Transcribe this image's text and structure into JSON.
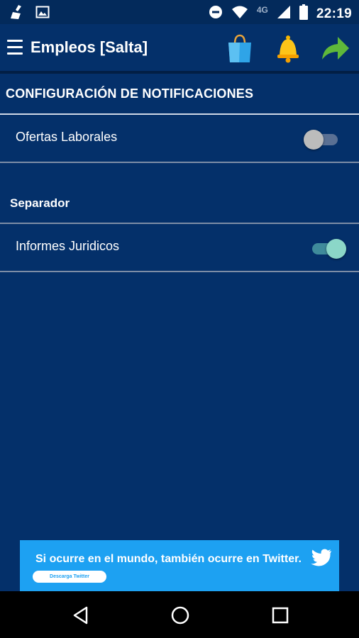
{
  "status_bar": {
    "time": "22:19",
    "network": "4G",
    "icons": [
      "cleaner-icon",
      "image-icon",
      "do-not-disturb-icon",
      "wifi-icon",
      "signal-icon",
      "battery-icon"
    ]
  },
  "app_bar": {
    "title": "Empleos [Salta]",
    "actions": [
      "shopping-bag-icon",
      "bell-icon",
      "share-arrow-icon"
    ]
  },
  "section": {
    "title": "CONFIGURACIÓN DE NOTIFICACIONES"
  },
  "settings": [
    {
      "label": "Ofertas Laborales",
      "enabled": false
    },
    {
      "label": "Informes Juridicos",
      "enabled": true
    }
  ],
  "separator": {
    "title": "Separador"
  },
  "ad": {
    "text": "Si ocurre en el mundo, también ocurre en Twitter.",
    "button_label": "Descarga Twitter",
    "background": "#1da1f2"
  },
  "nav_bar": {
    "buttons": [
      "back-icon",
      "home-icon",
      "recents-icon"
    ]
  },
  "colors": {
    "background": "#04306a",
    "toggle_on_thumb": "#8bd7c8",
    "toggle_off_thumb": "#bcbcbc"
  }
}
